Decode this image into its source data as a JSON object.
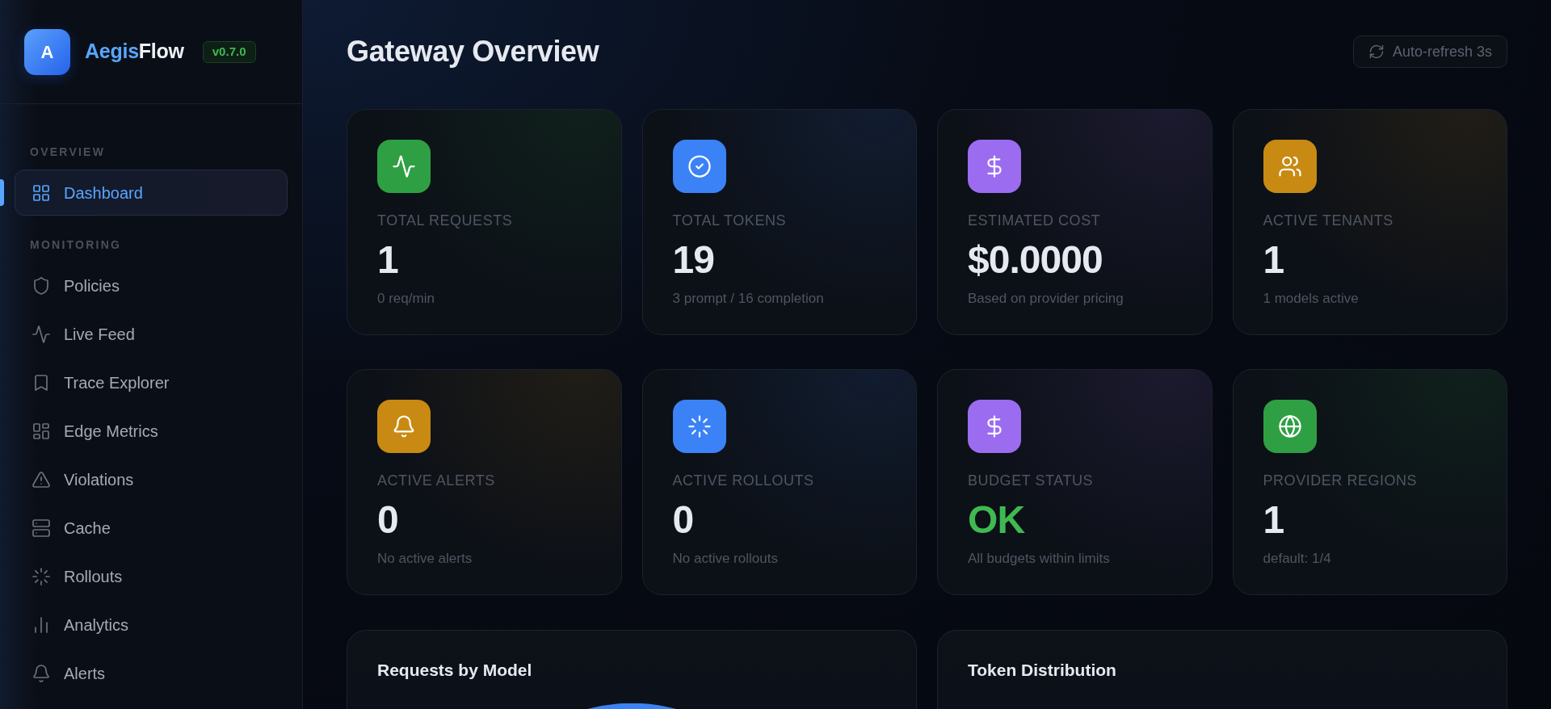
{
  "sidebar": {
    "logo_letter": "A",
    "app_name": {
      "primary": "Aegis",
      "secondary": "Flow"
    },
    "version": "v0.7.0",
    "sections": [
      {
        "heading": "OVERVIEW",
        "items": [
          {
            "label": "Dashboard",
            "selected": true
          }
        ]
      },
      {
        "heading": "MONITORING",
        "items": [
          {
            "label": "Policies",
            "selected": false
          },
          {
            "label": "Live Feed",
            "selected": false
          },
          {
            "label": "Trace Explorer",
            "selected": false
          },
          {
            "label": "Edge Metrics",
            "selected": false
          },
          {
            "label": "Violations",
            "selected": false
          },
          {
            "label": "Cache",
            "selected": false
          },
          {
            "label": "Rollouts",
            "selected": false
          },
          {
            "label": "Analytics",
            "selected": false
          },
          {
            "label": "Alerts",
            "selected": false
          }
        ]
      }
    ]
  },
  "header": {
    "title": "Gateway Overview",
    "refresh_button": "Auto-refresh 3s"
  },
  "stats": [
    {
      "label": "TOTAL REQUESTS",
      "value": "1",
      "caption": "0 req/min",
      "color": "#2ea043",
      "success": false
    },
    {
      "label": "TOTAL TOKENS",
      "value": "19",
      "caption": "3 prompt / 16 completion",
      "color": "#3b82f6",
      "success": false
    },
    {
      "label": "ESTIMATED COST",
      "value": "$0.0000",
      "caption": "Based on provider pricing",
      "color": "#9b6cf0",
      "success": false
    },
    {
      "label": "ACTIVE TENANTS",
      "value": "1",
      "caption": "1 models active",
      "color": "#c88a12",
      "success": false
    },
    {
      "label": "ACTIVE ALERTS",
      "value": "0",
      "caption": "No active alerts",
      "color": "#c88a12",
      "success": false
    },
    {
      "label": "ACTIVE ROLLOUTS",
      "value": "0",
      "caption": "No active rollouts",
      "color": "#3b82f6",
      "success": false
    },
    {
      "label": "BUDGET STATUS",
      "value": "OK",
      "caption": "All budgets within limits",
      "color": "#9b6cf0",
      "success": true
    },
    {
      "label": "PROVIDER REGIONS",
      "value": "1",
      "caption": "default: 1/4",
      "color": "#2ea043",
      "success": false
    }
  ],
  "charts": [
    {
      "title": "Requests by Model"
    },
    {
      "title": "Token Distribution"
    }
  ]
}
